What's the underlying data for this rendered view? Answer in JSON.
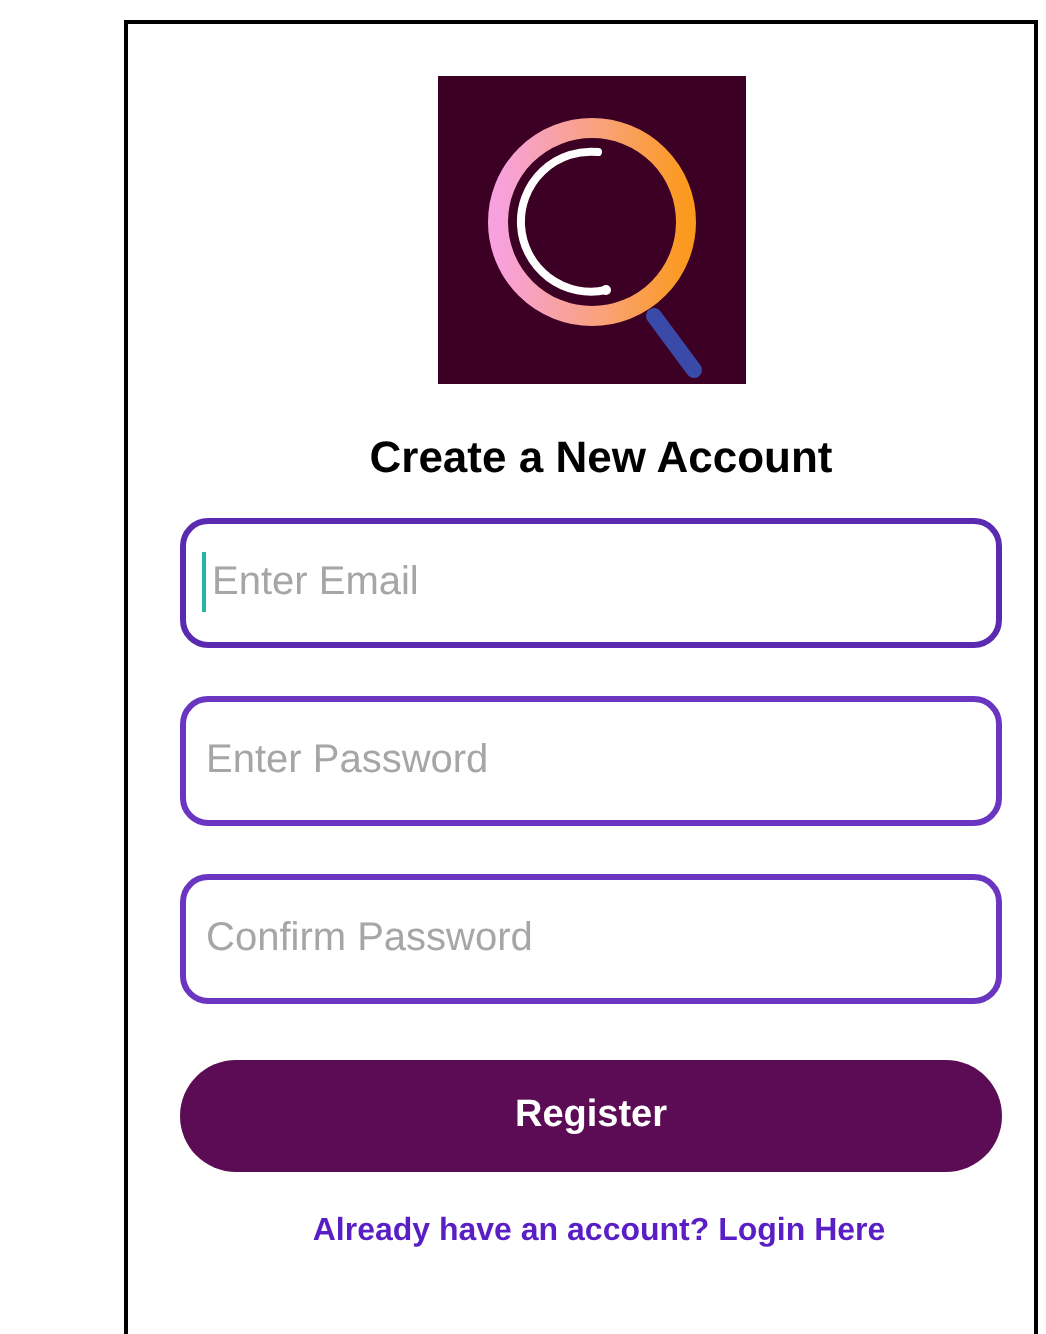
{
  "title": "Create a New Account",
  "fields": [
    {
      "placeholder": "Enter Email",
      "focused": true
    },
    {
      "placeholder": "Enter Password",
      "focused": false
    },
    {
      "placeholder": "Confirm Password",
      "focused": false
    }
  ],
  "register_button": "Register",
  "login_link": "Already have an account? Login Here"
}
